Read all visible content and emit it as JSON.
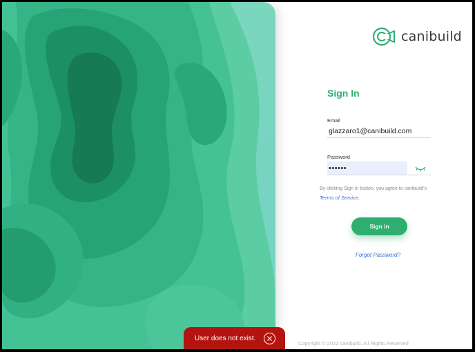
{
  "brand": {
    "name": "canibuild",
    "logo_icon": "camera-c-logo-icon",
    "accent": "#2fae72"
  },
  "form": {
    "title": "Sign In",
    "email_label": "Email",
    "email_value": "glazzaro1@canibuild.com",
    "password_label": "Password",
    "password_value": "••••••",
    "password_toggle_icon": "eye-closed-icon",
    "terms_prefix": "By clicking Sign in button, you agree to canibuild's",
    "terms_link": "Terms of Service.",
    "submit_label": "Sign in",
    "forgot_label": "Forgot Password?"
  },
  "footer": {
    "copyright": "Copyright © 2022 canibuild. All Rights Reserved"
  },
  "toast": {
    "message": "User does not exist.",
    "close_icon": "close-icon",
    "color": "#b3140f"
  }
}
